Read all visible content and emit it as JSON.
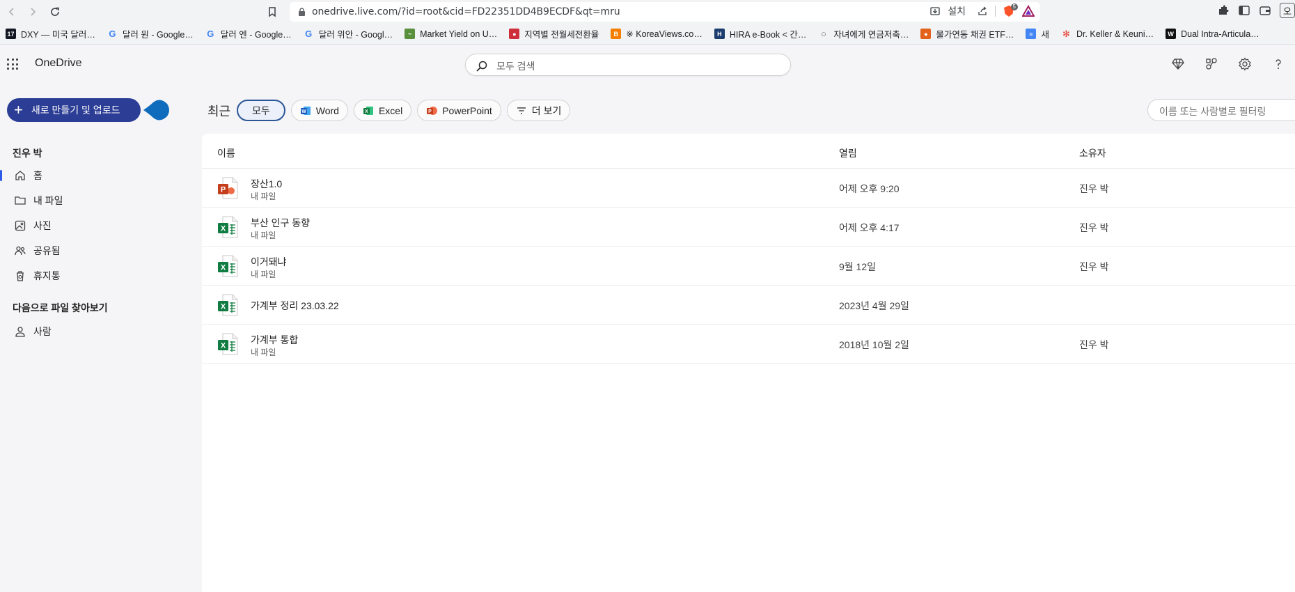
{
  "browser": {
    "url": "onedrive.live.com/?id=root&cid=FD22351DD4B9ECDF&qt=mru",
    "install_label": "설치",
    "ext_badge": "5",
    "profile_char": "오",
    "bookmarks": [
      {
        "label": "DXY — 미국 달러…",
        "icon": "tv-icon",
        "color": "#131722",
        "glyph": "17"
      },
      {
        "label": "달러 원 - Google…",
        "icon": "google-icon",
        "color": "#4285f4",
        "glyph": "G"
      },
      {
        "label": "달러 엔 - Google…",
        "icon": "google-icon",
        "color": "#4285f4",
        "glyph": "G"
      },
      {
        "label": "달러 위안 - Googl…",
        "icon": "google-icon",
        "color": "#4285f4",
        "glyph": "G"
      },
      {
        "label": "Market Yield on U…",
        "icon": "chart-icon",
        "color": "#5a8f3c",
        "glyph": "~"
      },
      {
        "label": "지역별 전월세전환율",
        "icon": "korea-flag-icon",
        "color": "#cd2e3a",
        "glyph": "●"
      },
      {
        "label": "※ KoreaViews.co…",
        "icon": "blogger-icon",
        "color": "#f57d00",
        "glyph": "B"
      },
      {
        "label": "HIRA e-Book < 간…",
        "icon": "hira-icon",
        "color": "#1d3c6e",
        "glyph": "H"
      },
      {
        "label": "자녀에게 연금저축…",
        "icon": "globe-icon",
        "color": "#5f6368",
        "glyph": "○"
      },
      {
        "label": "물가연동 채권 ETF…",
        "icon": "etf-icon",
        "color": "#e2621b",
        "glyph": "●"
      },
      {
        "label": "새",
        "icon": "doc-icon",
        "color": "#4285f4",
        "glyph": "≡"
      },
      {
        "label": "Dr. Keller & Keuni…",
        "icon": "pinwheel-icon",
        "color": "#e8453c",
        "glyph": "✻"
      },
      {
        "label": "Dual Intra-Articula…",
        "icon": "w-icon",
        "color": "#111111",
        "glyph": "W"
      }
    ]
  },
  "app": {
    "title": "OneDrive",
    "search_placeholder": "모두 검색"
  },
  "sidebar": {
    "new_button": "새로 만들기 및 업로드",
    "user_name": "진우 박",
    "nav": [
      {
        "label": "홈",
        "name": "sidebar-item-home",
        "icon": "home-icon",
        "active": true
      },
      {
        "label": "내 파일",
        "name": "sidebar-item-my-files",
        "icon": "folder-icon",
        "active": false
      },
      {
        "label": "사진",
        "name": "sidebar-item-photos",
        "icon": "photo-icon",
        "active": false
      },
      {
        "label": "공유됨",
        "name": "sidebar-item-shared",
        "icon": "people-icon",
        "active": false
      },
      {
        "label": "휴지통",
        "name": "sidebar-item-recycle-bin",
        "icon": "trash-icon",
        "active": false
      }
    ],
    "browse_section": "다음으로 파일 찾아보기",
    "browse_items": [
      {
        "label": "사람",
        "icon": "person-icon"
      }
    ]
  },
  "filters": {
    "recent_label": "최근",
    "chips": [
      {
        "label": "모두",
        "selected": true
      },
      {
        "label": "Word",
        "icon": "word-icon"
      },
      {
        "label": "Excel",
        "icon": "excel-icon"
      },
      {
        "label": "PowerPoint",
        "icon": "powerpoint-icon"
      },
      {
        "label": "더 보기",
        "icon": "filter-icon"
      }
    ],
    "filter_placeholder": "이름 또는 사람별로 필터링"
  },
  "table": {
    "columns": {
      "name": "이름",
      "opened": "열림",
      "owner": "소유자"
    },
    "rows": [
      {
        "name": "장산1.0",
        "location": "내 파일",
        "opened": "어제 오후 9:20",
        "owner": "진우 박",
        "type": "powerpoint"
      },
      {
        "name": "부산 인구 동향",
        "location": "내 파일",
        "opened": "어제 오후 4:17",
        "owner": "진우 박",
        "type": "excel"
      },
      {
        "name": "이거돼냐",
        "location": "내 파일",
        "opened": "9월 12일",
        "owner": "진우 박",
        "type": "excel"
      },
      {
        "name": "가계부 정리 23.03.22",
        "location": "",
        "opened": "2023년 4월 29일",
        "owner": "",
        "type": "excel"
      },
      {
        "name": "가계부 통합",
        "location": "내 파일",
        "opened": "2018년 10월 2일",
        "owner": "진우 박",
        "type": "excel"
      }
    ]
  },
  "colors": {
    "accent": "#2c3d96",
    "excel": "#107c41",
    "powerpoint": "#c43e1c",
    "word": "#185abd"
  }
}
